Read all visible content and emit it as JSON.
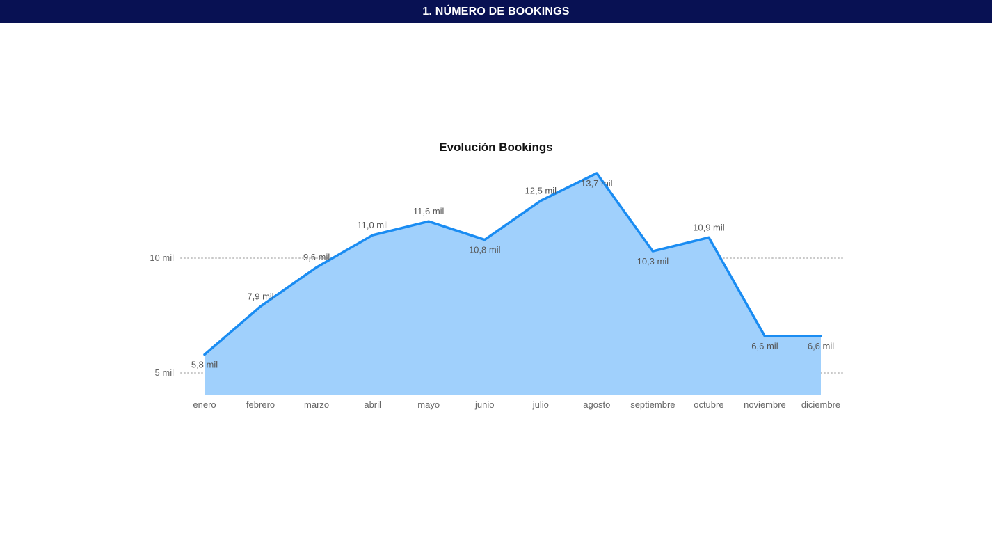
{
  "header": {
    "title": "1. NÚMERO DE BOOKINGS"
  },
  "chart_data": {
    "type": "area",
    "title": "Evolución Bookings",
    "xlabel": "",
    "ylabel": "",
    "categories": [
      "enero",
      "febrero",
      "marzo",
      "abril",
      "mayo",
      "junio",
      "julio",
      "agosto",
      "septiembre",
      "octubre",
      "noviembre",
      "diciembre"
    ],
    "values": [
      5800,
      7900,
      9600,
      11000,
      11600,
      10800,
      12500,
      13700,
      10300,
      10900,
      6600,
      6600
    ],
    "data_labels": [
      "5,8 mil",
      "7,9 mil",
      "9,6 mil",
      "11,0 mil",
      "11,6 mil",
      "10,8 mil",
      "12,5 mil",
      "13,7 mil",
      "10,3 mil",
      "10,9 mil",
      "6,6 mil",
      "6,6 mil"
    ],
    "yticks": [
      5000,
      10000
    ],
    "ytick_labels": [
      "5 mil",
      "10 mil"
    ],
    "ylim": [
      4000,
      14000
    ],
    "grid": true,
    "colors": {
      "line": "#1a8cf2",
      "fill": "#a0d0fc",
      "grid": "#c8c8c8"
    }
  }
}
